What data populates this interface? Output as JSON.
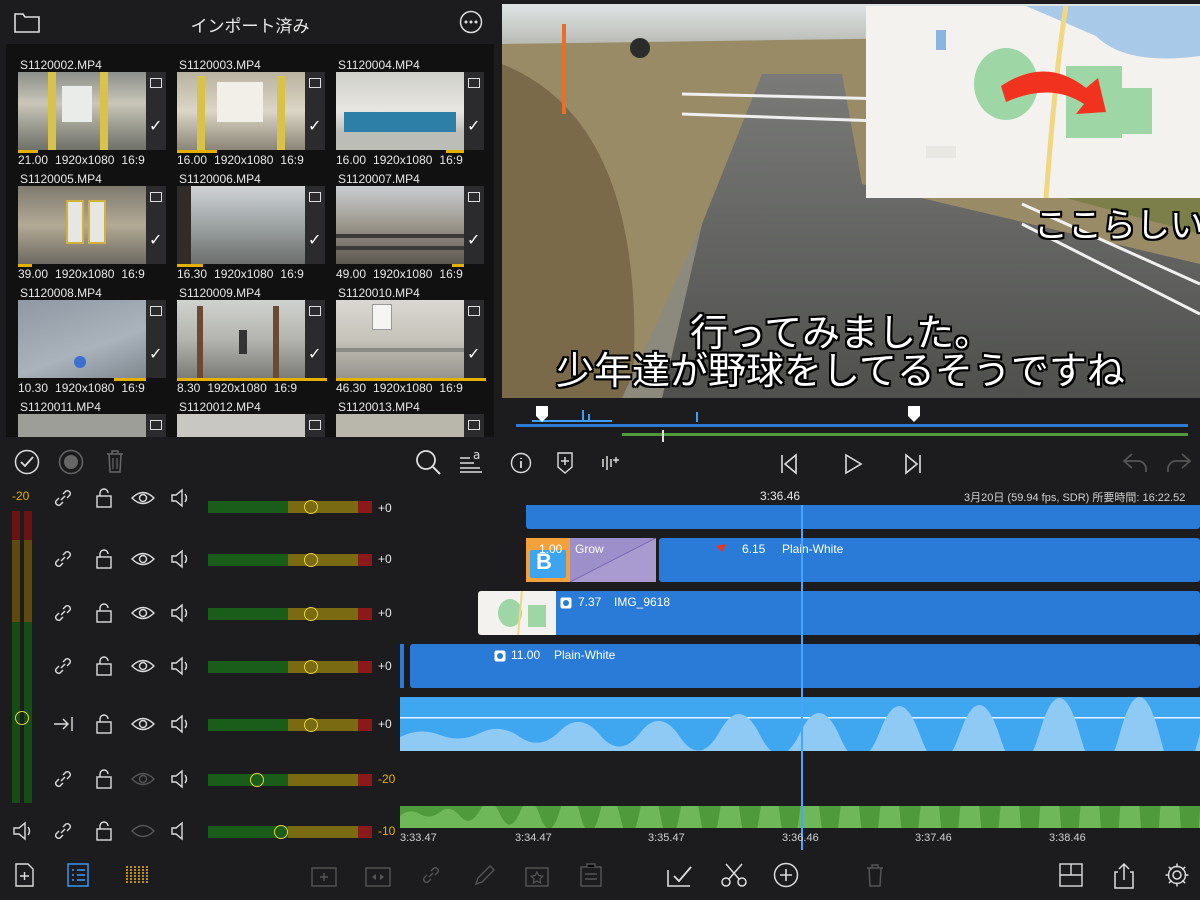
{
  "library": {
    "title": "インポート済み",
    "clips": [
      {
        "name": "S1120002.MP4",
        "duration": "21.00",
        "resolution": "1920x1080",
        "aspect": "16:9",
        "used": 0.15
      },
      {
        "name": "S1120003.MP4",
        "duration": "16.00",
        "resolution": "1920x1080",
        "aspect": "16:9",
        "used": 0.3
      },
      {
        "name": "S1120004.MP4",
        "duration": "16.00",
        "resolution": "1920x1080",
        "aspect": "16:9",
        "used": 0.15
      },
      {
        "name": "S1120005.MP4",
        "duration": "39.00",
        "resolution": "1920x1080",
        "aspect": "16:9",
        "used": 0.1
      },
      {
        "name": "S1120006.MP4",
        "duration": "16.30",
        "resolution": "1920x1080",
        "aspect": "16:9",
        "used": 0.2
      },
      {
        "name": "S1120007.MP4",
        "duration": "49.00",
        "resolution": "1920x1080",
        "aspect": "16:9",
        "used": 0.1
      },
      {
        "name": "S1120008.MP4",
        "duration": "10.30",
        "resolution": "1920x1080",
        "aspect": "16:9",
        "used": 0.3
      },
      {
        "name": "S1120009.MP4",
        "duration": "8.30",
        "resolution": "1920x1080",
        "aspect": "16:9",
        "used": 1.0
      },
      {
        "name": "S1120010.MP4",
        "duration": "46.30",
        "resolution": "1920x1080",
        "aspect": "16:9",
        "used": 1.0
      },
      {
        "name": "S1120011.MP4",
        "duration": "",
        "resolution": "",
        "aspect": "",
        "used": 0
      },
      {
        "name": "S1120012.MP4",
        "duration": "",
        "resolution": "",
        "aspect": "",
        "used": 0
      },
      {
        "name": "S1120013.MP4",
        "duration": "",
        "resolution": "",
        "aspect": "",
        "used": 0
      }
    ]
  },
  "viewer": {
    "caption_line1": "行ってみました。",
    "caption_line2": "少年達が野球をしてるそうですね",
    "caption_side": "ここらしい"
  },
  "timeline": {
    "current_time": "3:36.46",
    "info": "3月20日 (59.94 fps, SDR)  所要時間: 16:22.52",
    "meter_top_label": "-20",
    "clips": [
      {
        "label_num": "1.00",
        "label": "Grow"
      },
      {
        "label_num": "6.15",
        "label": "Plain-White"
      },
      {
        "label_num": "7.37",
        "label": "IMG_9618"
      },
      {
        "label_num": "11.00",
        "label": "Plain-White"
      }
    ],
    "ruler": [
      "3:33.47",
      "3:34.47",
      "3:35.47",
      "3:36.46",
      "3:37.46",
      "3:38.46"
    ],
    "tracks": [
      {
        "value": "+0",
        "level": 0.65
      },
      {
        "value": "+0",
        "level": 0.65
      },
      {
        "value": "+0",
        "level": 0.65
      },
      {
        "value": "+0",
        "level": 0.65
      },
      {
        "value": "+0",
        "level": 0.65
      },
      {
        "value": "-20",
        "level": 0.3
      },
      {
        "value": "-10",
        "level": 0.45
      }
    ]
  },
  "colors": {
    "accent": "#e5b100",
    "clip_blue": "#2a7bd8",
    "audio_blue": "#3fa6f0",
    "audio_green": "#4f9a3a"
  }
}
